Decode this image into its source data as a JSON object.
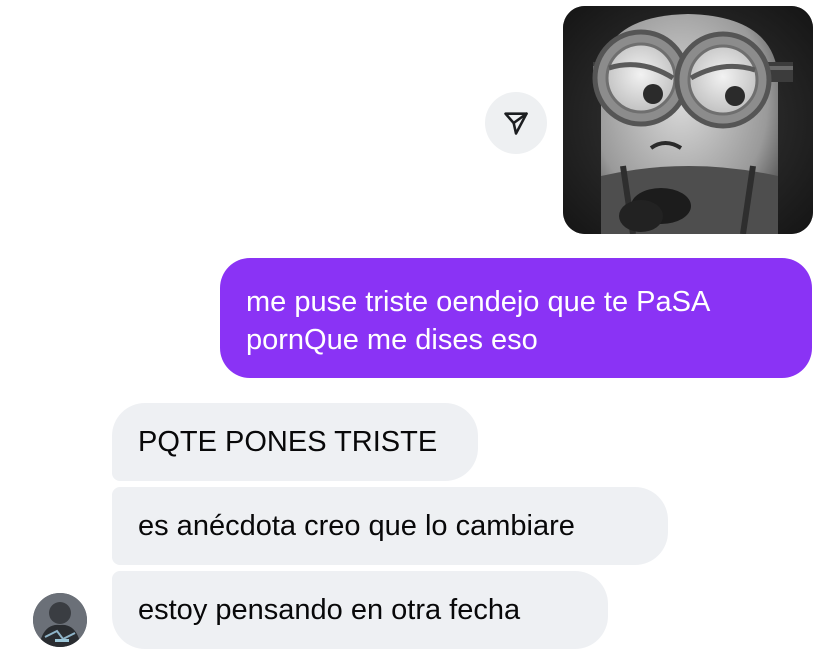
{
  "conversation": {
    "shared_image": {
      "description_icon": "minion-sad-image"
    },
    "share_icon": "send-arrow-icon",
    "outgoing": {
      "line1": "me puse triste oendejo que te PaSA",
      "line2": "pornQue me dises eso",
      "color": "#8a33f5"
    },
    "incoming": [
      {
        "text": "PQTE PONES TRISTE"
      },
      {
        "text": "es anécdota creo que lo cambiare"
      },
      {
        "text": "estoy pensando en otra fecha"
      }
    ],
    "incoming_color": "#eef0f3"
  }
}
